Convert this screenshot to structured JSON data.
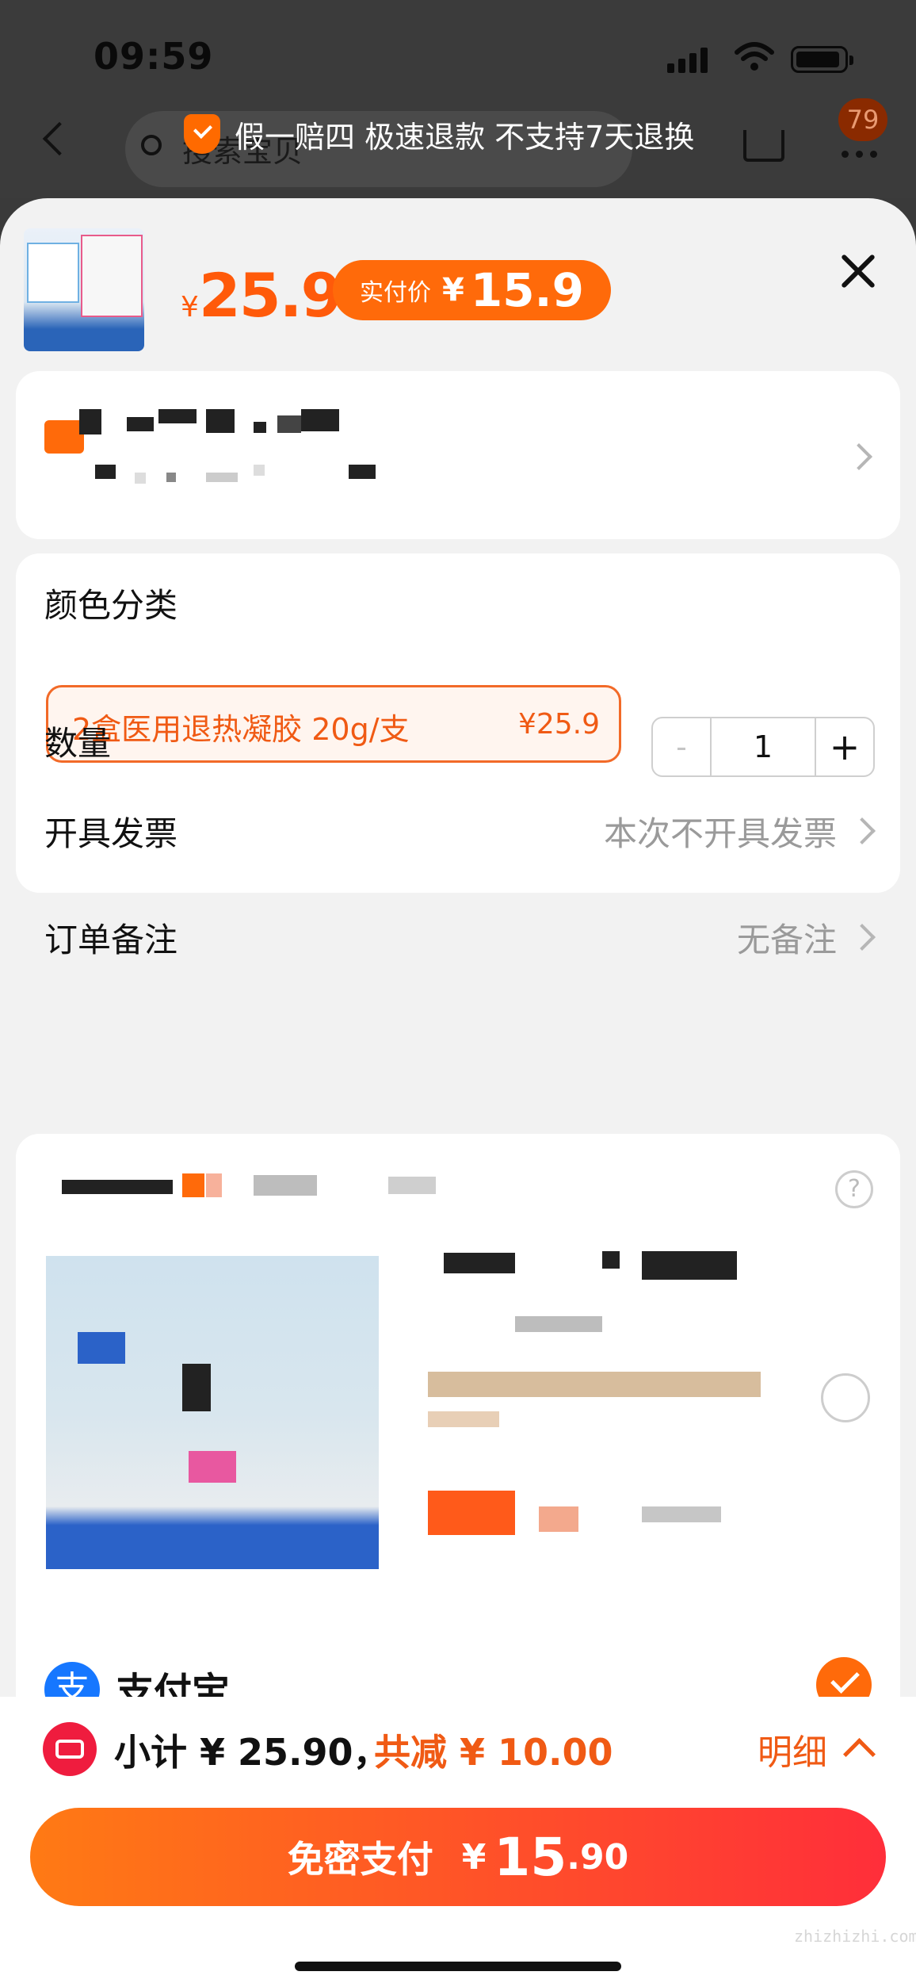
{
  "status_bar": {
    "time": "09:59"
  },
  "top_bar": {
    "search_placeholder": "搜索宝贝",
    "guarantee_banner": "假一赔四 极速退款 不支持7天退换",
    "notification_count": "79"
  },
  "product": {
    "price_currency": "¥",
    "price": "25.9",
    "paid_label": "实付价",
    "paid_currency": "¥",
    "paid_price": "15.9"
  },
  "options": {
    "color_label": "颜色分类",
    "selected_option": "2盒医用退热凝胶 20g/支",
    "selected_option_price": "¥25.9",
    "quantity_label": "数量",
    "quantity": "1",
    "minus": "-",
    "plus": "+",
    "invoice_label": "开具发票",
    "invoice_value": "本次不开具发票",
    "note_label": "订单备注",
    "note_value": "无备注"
  },
  "promo": {
    "help": "?"
  },
  "payment": {
    "icon_glyph": "支",
    "method": "支付宝",
    "selected": true
  },
  "footer": {
    "subtotal": "小计 ¥ 25.90，",
    "discount": "共减 ¥ 10.00",
    "detail_label": "明细",
    "pay_label": "免密支付",
    "pay_currency": "¥",
    "pay_amount_int": "15",
    "pay_amount_dec": ".90",
    "watermark": "zhizhizhi.com"
  },
  "colors": {
    "accent": "#ff6a0a",
    "price": "#f05a14",
    "alipay": "#1677ff",
    "coupon": "#ef1c3e"
  }
}
